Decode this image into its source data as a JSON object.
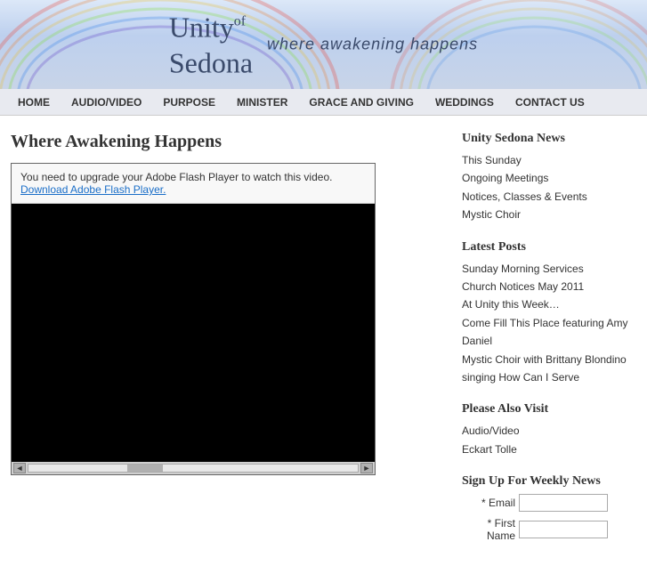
{
  "header": {
    "logo_line1": "Unity",
    "logo_of": "of",
    "logo_line2": "Sedona",
    "tagline": "where awakening happens"
  },
  "nav": {
    "items": [
      {
        "label": "HOME",
        "active": true
      },
      {
        "label": "AUDIO/VIDEO",
        "active": false
      },
      {
        "label": "PURPOSE",
        "active": false
      },
      {
        "label": "MINISTER",
        "active": false
      },
      {
        "label": "GRACE AND GIVING",
        "active": false
      },
      {
        "label": "WEDDINGS",
        "active": false
      },
      {
        "label": "CONTACT US",
        "active": false
      }
    ]
  },
  "content": {
    "page_title": "Where Awakening Happens",
    "flash_notice": "You need to upgrade your Adobe Flash Player to watch this video.",
    "flash_download": "Download Adobe Flash Player."
  },
  "sidebar": {
    "news_title": "Unity Sedona News",
    "news_links": [
      "This Sunday",
      "Ongoing Meetings",
      "Notices, Classes & Events",
      "Mystic Choir"
    ],
    "posts_title": "Latest Posts",
    "posts_links": [
      "Sunday Morning Services",
      "Church Notices May 2011",
      "At Unity this Week…",
      "Come Fill This Place featuring Amy Daniel",
      "Mystic Choir with Brittany Blondino",
      "singing How Can I Serve"
    ],
    "visit_title": "Please Also Visit",
    "visit_links": [
      "Audio/Video",
      "Eckart Tolle"
    ],
    "signup_title": "Sign Up For Weekly News",
    "signup_email_label": "* Email",
    "signup_firstname_label": "* First",
    "signup_firstname_label2": "Name"
  },
  "scrollbar": {
    "left": "◄",
    "right": "►"
  }
}
